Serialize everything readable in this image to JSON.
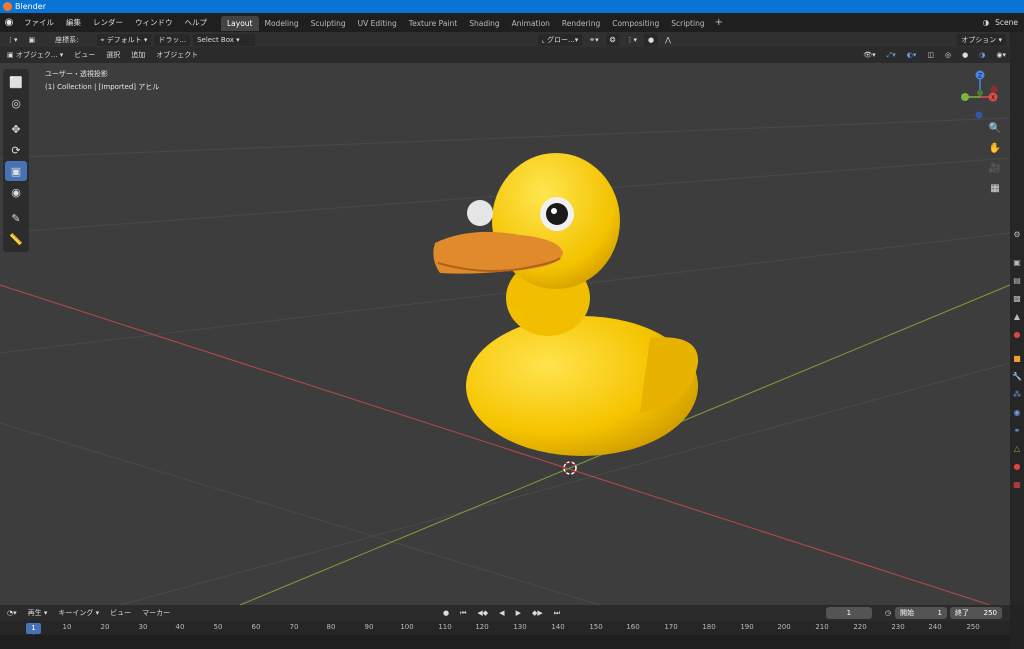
{
  "window": {
    "title": "Blender"
  },
  "menu": {
    "items": [
      "ファイル",
      "編集",
      "レンダー",
      "ウィンドウ",
      "ヘルプ"
    ]
  },
  "workspaces": {
    "tabs": [
      "Layout",
      "Modeling",
      "Sculpting",
      "UV Editing",
      "Texture Paint",
      "Shading",
      "Animation",
      "Rendering",
      "Compositing",
      "Scripting"
    ],
    "active_index": 0
  },
  "scene": {
    "name": "Scene"
  },
  "tool_header": {
    "orientation_label": "座標系:",
    "orientation_value": "デフォルト",
    "drag_label": "ドラッ...",
    "select_mode": "Select Box",
    "transform_orientation": "グロー...",
    "options": "オプション"
  },
  "view_header": {
    "mode": "オブジェク...",
    "menus": [
      "ビュー",
      "選択",
      "追加",
      "オブジェクト"
    ]
  },
  "viewport": {
    "view_name": "ユーザー・透視投影",
    "collection_info": "(1) Collection | [Imported] アヒル",
    "colors": {
      "background": "#3d3d3d",
      "grid": "#4a4a4a",
      "x_axis": "#b84a4a",
      "y_axis": "#7ea13a",
      "duck_body": "#f5c400",
      "duck_beak": "#e08a2c"
    }
  },
  "toolbar": {
    "tools": [
      "select-box",
      "cursor",
      "move",
      "rotate",
      "scale",
      "transform",
      "annotate",
      "measure"
    ],
    "active_tool": "scale"
  },
  "nav_gizmo": {
    "axes": [
      "X",
      "Y",
      "Z"
    ]
  },
  "timeline": {
    "menus": [
      "再生",
      "キーイング",
      "ビュー",
      "マーカー"
    ],
    "current_frame": "1",
    "start_label": "開始",
    "start_value": "1",
    "end_label": "終了",
    "end_value": "250",
    "ruler_marks": [
      "1",
      "10",
      "20",
      "30",
      "40",
      "50",
      "60",
      "70",
      "80",
      "90",
      "100",
      "110",
      "120",
      "130",
      "140",
      "150",
      "160",
      "170",
      "180",
      "190",
      "200",
      "210",
      "220",
      "230",
      "240",
      "250"
    ]
  }
}
